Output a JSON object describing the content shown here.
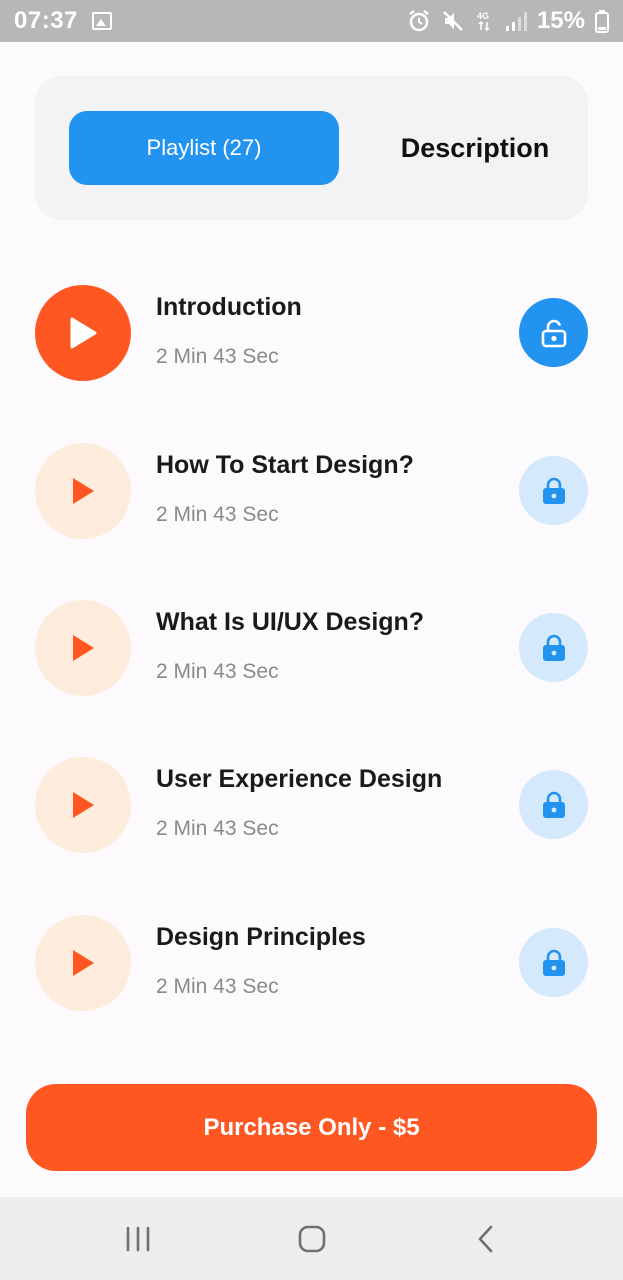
{
  "status_bar": {
    "time": "07:37",
    "battery": "15%",
    "icons": [
      "gallery-icon",
      "alarm-icon",
      "mute-icon",
      "network-4g-icon",
      "signal-icon",
      "battery-icon"
    ]
  },
  "tabs": {
    "playlist_label": "Playlist (27)",
    "description_label": "Description"
  },
  "lessons": [
    {
      "title": "Introduction",
      "duration": "2 Min 43 Sec",
      "state": "unlocked"
    },
    {
      "title": "How To Start Design?",
      "duration": "2 Min 43 Sec",
      "state": "locked"
    },
    {
      "title": "What Is UI/UX Design?",
      "duration": "2 Min 43 Sec",
      "state": "locked"
    },
    {
      "title": "User Experience Design",
      "duration": "2 Min 43 Sec",
      "state": "locked"
    },
    {
      "title": "Design Principles",
      "duration": "2 Min 43 Sec",
      "state": "locked"
    }
  ],
  "purchase": {
    "label": "Purchase Only - $5"
  },
  "colors": {
    "accent_blue": "#2393f0",
    "accent_orange": "#fe5722",
    "light_orange": "#fdebdc",
    "light_blue": "#d4e9fc"
  }
}
